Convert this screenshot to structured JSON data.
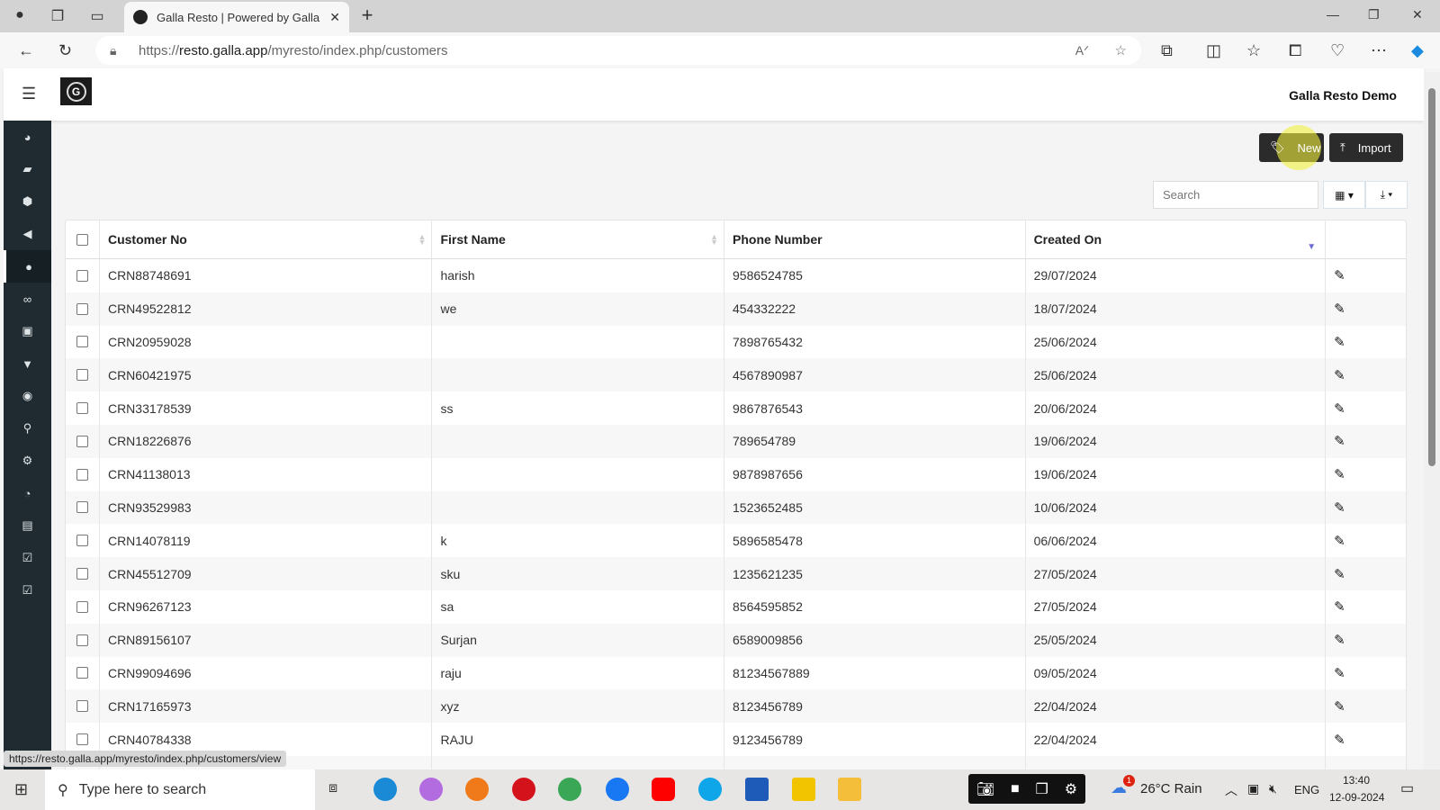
{
  "browser": {
    "tab_title": "Galla Resto | Powered by Galla",
    "url_prefix": "https://",
    "url_domain": "resto.galla.app",
    "url_path": "/myresto/index.php/customers",
    "status_url": "https://resto.galla.app/myresto/index.php/customers/view"
  },
  "header": {
    "brand": "Galla Resto Demo",
    "logo_letter": "G"
  },
  "sidebar": {
    "items": [
      "dashboard",
      "folder",
      "cube",
      "bullhorn",
      "user-circle",
      "handshake",
      "gift",
      "basket",
      "users",
      "map-marker",
      "gear",
      "pie-chart",
      "money",
      "check-square",
      "check-square-2"
    ],
    "active": 4
  },
  "toolbar": {
    "new_label": "New",
    "import_label": "Import",
    "search_placeholder": "Search"
  },
  "table": {
    "columns": [
      "Customer No",
      "First Name",
      "Phone Number",
      "Created On"
    ],
    "sorted_column": "Created On",
    "sort_direction": "desc",
    "rows": [
      [
        "CRN88748691",
        "harish",
        "9586524785",
        "29/07/2024"
      ],
      [
        "CRN49522812",
        "we",
        "454332222",
        "18/07/2024"
      ],
      [
        "CRN20959028",
        "",
        "7898765432",
        "25/06/2024"
      ],
      [
        "CRN60421975",
        "",
        "4567890987",
        "25/06/2024"
      ],
      [
        "CRN33178539",
        "ss",
        "9867876543",
        "20/06/2024"
      ],
      [
        "CRN18226876",
        "",
        "789654789",
        "19/06/2024"
      ],
      [
        "CRN41138013",
        "",
        "9878987656",
        "19/06/2024"
      ],
      [
        "CRN93529983",
        "",
        "1523652485",
        "10/06/2024"
      ],
      [
        "CRN14078119",
        "k",
        "5896585478",
        "06/06/2024"
      ],
      [
        "CRN45512709",
        "sku",
        "1235621235",
        "27/05/2024"
      ],
      [
        "CRN96267123",
        "sa",
        "8564595852",
        "27/05/2024"
      ],
      [
        "CRN89156107",
        "Surjan",
        "6589009856",
        "25/05/2024"
      ],
      [
        "CRN99094696",
        "raju",
        "81234567889",
        "09/05/2024"
      ],
      [
        "CRN17165973",
        "xyz",
        "8123456789",
        "22/04/2024"
      ],
      [
        "CRN40784338",
        "RAJU",
        "9123456789",
        "22/04/2024"
      ]
    ]
  },
  "taskbar": {
    "search_placeholder": "Type here to search",
    "weather": "26°C  Rain",
    "weather_badge": "1",
    "lang": "ENG",
    "time": "13:40",
    "date": "12-09-2024"
  }
}
